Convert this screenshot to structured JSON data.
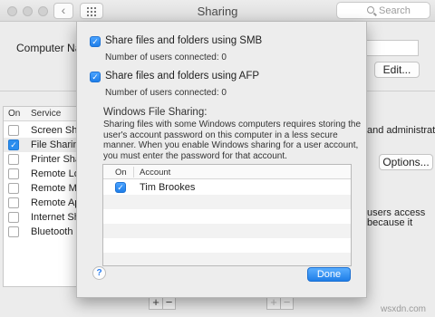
{
  "window": {
    "title": "Sharing"
  },
  "nav": {
    "back": "‹",
    "forward": "›",
    "grid_icon": "grid-icon"
  },
  "search": {
    "placeholder": "Search",
    "icon": "search-icon"
  },
  "background": {
    "computer_name_label": "Computer Name:",
    "edit_button": "Edit...",
    "options_button": "Options...",
    "table_head": {
      "on": "On",
      "service": "Service"
    },
    "services": [
      {
        "name": "Screen Sharing",
        "checked": false,
        "selected": false
      },
      {
        "name": "File Sharing",
        "checked": true,
        "selected": true
      },
      {
        "name": "Printer Sharing",
        "checked": false,
        "selected": false
      },
      {
        "name": "Remote Login",
        "checked": false,
        "selected": false
      },
      {
        "name": "Remote Management",
        "checked": false,
        "selected": false
      },
      {
        "name": "Remote Apple Events",
        "checked": false,
        "selected": false
      },
      {
        "name": "Internet Sharing",
        "checked": false,
        "selected": false
      },
      {
        "name": "Bluetooth Sharing",
        "checked": false,
        "selected": false
      }
    ],
    "right_text": {
      "admins": "and administrators",
      "users_access": "users access",
      "because": "because it"
    },
    "plus": "+",
    "minus": "−"
  },
  "sheet": {
    "smb": {
      "label": "Share files and folders using SMB",
      "checked": true,
      "users": "Number of users connected: 0"
    },
    "afp": {
      "label": "Share files and folders using AFP",
      "checked": true,
      "users": "Number of users connected: 0"
    },
    "windows_heading": "Windows File Sharing:",
    "description": "Sharing files with some Windows computers requires storing the user's account password on this computer in a less secure manner.  When you enable Windows sharing for a user account, you must enter the password for that account.",
    "table_head": {
      "on": "On",
      "account": "Account"
    },
    "accounts": [
      {
        "name": "Tim Brookes",
        "checked": true
      }
    ],
    "help": "?",
    "done": "Done"
  },
  "watermark": "wsxdn.com",
  "colors": {
    "accent": "#2a8dee",
    "done_button": "#1f7ee8"
  }
}
